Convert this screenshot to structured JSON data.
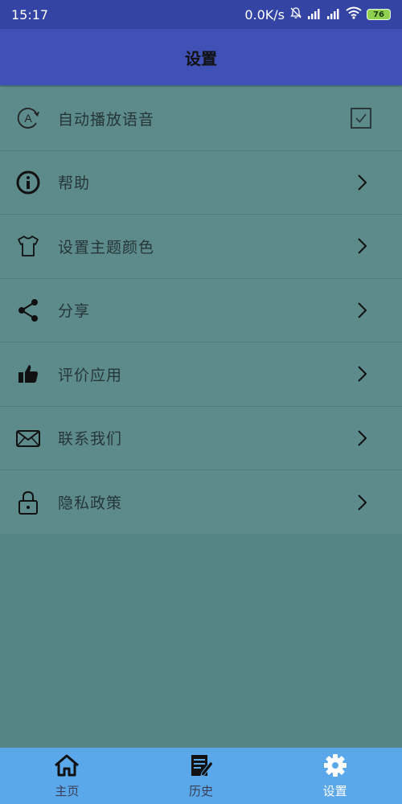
{
  "status_bar": {
    "time": "15:17",
    "network_speed": "0.0K/s",
    "battery": "76",
    "icons": [
      "mute-bell-icon",
      "signal-icon",
      "signal-icon",
      "wifi-icon",
      "battery-icon"
    ]
  },
  "appbar": {
    "title": "设置"
  },
  "settings": [
    {
      "label": "自动播放语音",
      "icon": "auto-play-icon",
      "trailing": "checkbox",
      "checked": true
    },
    {
      "label": "帮助",
      "icon": "info-icon",
      "trailing": "chevron"
    },
    {
      "label": "设置主题颜色",
      "icon": "tshirt-icon",
      "trailing": "chevron"
    },
    {
      "label": "分享",
      "icon": "share-icon",
      "trailing": "chevron"
    },
    {
      "label": "评价应用",
      "icon": "thumbs-up-icon",
      "trailing": "chevron"
    },
    {
      "label": "联系我们",
      "icon": "envelope-icon",
      "trailing": "chevron"
    },
    {
      "label": "隐私政策",
      "icon": "lock-icon",
      "trailing": "chevron"
    }
  ],
  "bottom_nav": {
    "items": [
      {
        "label": "主页",
        "icon": "home-icon",
        "active": false
      },
      {
        "label": "历史",
        "icon": "history-icon",
        "active": false
      },
      {
        "label": "设置",
        "icon": "gear-icon",
        "active": true
      }
    ]
  },
  "colors": {
    "status_bar": "#3444a4",
    "appbar": "#3f51b5",
    "list_bg": "#5d8b8b",
    "page_bg": "#558686",
    "bottom_nav": "#5aa7e9",
    "active_nav": "#ffffff",
    "inactive_nav": "#3a3f55"
  }
}
